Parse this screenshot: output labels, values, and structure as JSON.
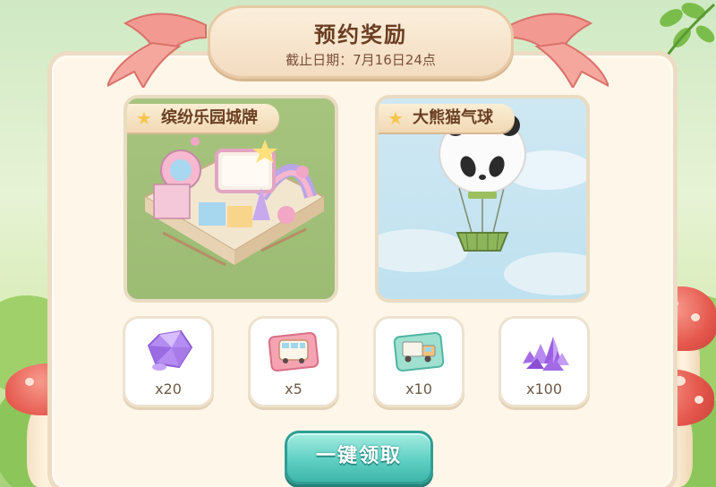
{
  "header": {
    "title": "预约奖励",
    "deadline": "截止日期：7月16日24点"
  },
  "cards": [
    {
      "label": "缤纷乐园城牌",
      "image": "amusement-park-sign-illustration"
    },
    {
      "label": "大熊猫气球",
      "image": "panda-balloon-illustration"
    }
  ],
  "items": [
    {
      "icon": "purple-gem-icon",
      "qty": "x20"
    },
    {
      "icon": "bus-ticket-icon",
      "qty": "x5"
    },
    {
      "icon": "truck-ticket-icon",
      "qty": "x10"
    },
    {
      "icon": "crystal-pile-icon",
      "qty": "x100"
    }
  ],
  "claim_button": {
    "label": "一键领取"
  },
  "colors": {
    "panel_bg": "#fdf6e9",
    "title_brown": "#6a3e22",
    "button_teal": "#5fd0c3",
    "ribbon_pink": "#f29a91"
  }
}
